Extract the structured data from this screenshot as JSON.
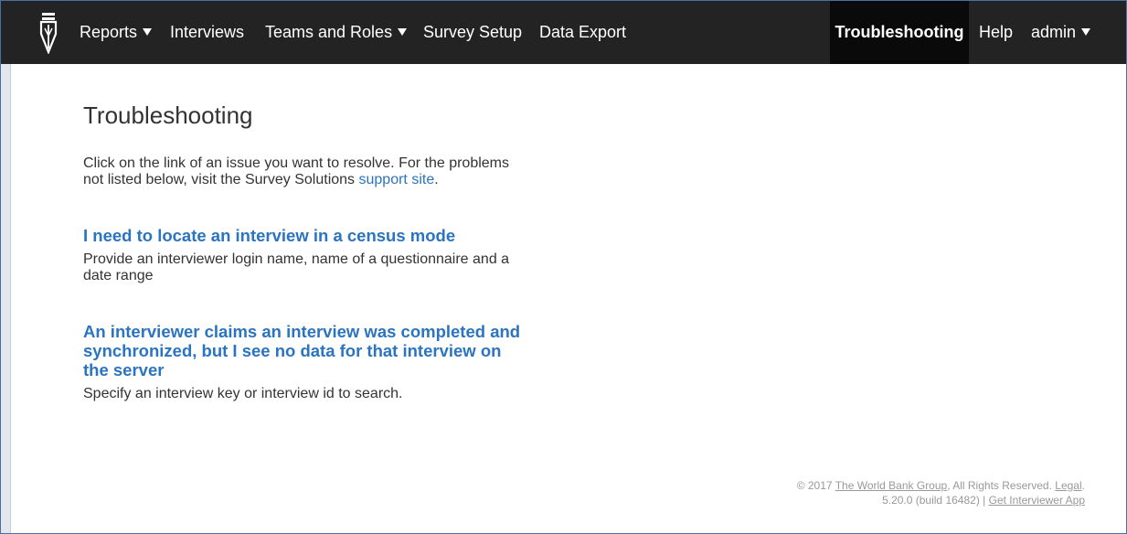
{
  "nav": {
    "logo_icon": "pen-nib-logo-icon",
    "items": [
      {
        "label": "Reports",
        "dropdown": true
      },
      {
        "label": "Interviews",
        "dropdown": false
      },
      {
        "label": "Teams and Roles",
        "dropdown": true
      },
      {
        "label": "Survey Setup",
        "dropdown": false
      },
      {
        "label": "Data Export",
        "dropdown": false
      }
    ],
    "active": "Troubleshooting",
    "help": "Help",
    "user": "admin",
    "background": "#232323",
    "active_background": "#0a0a0a"
  },
  "main": {
    "title": "Troubleshooting",
    "intro_text": "Click on the link of an issue you want to resolve. For the problems not listed below, visit the Survey Solutions",
    "intro_link": "support site",
    "intro_end": ".",
    "issues": [
      {
        "title": "I need to locate an interview in a census mode",
        "description": "Provide an interviewer login name, name of a questionnaire and a date range"
      },
      {
        "title": "An interviewer claims an interview was completed and synchronized, but I see no data for that interview on the server",
        "description": "Specify an interview key or interview id to search."
      }
    ],
    "link_color": "#2a74c1"
  },
  "footer": {
    "copyright_prefix": "© 2017",
    "org_link": "The World Bank Group",
    "rights": ", All Rights Reserved.",
    "legal_link": "Legal",
    "legal_end": ".",
    "version": "5.20.0 (build 16482) |",
    "app_link": "Get Interviewer App"
  }
}
